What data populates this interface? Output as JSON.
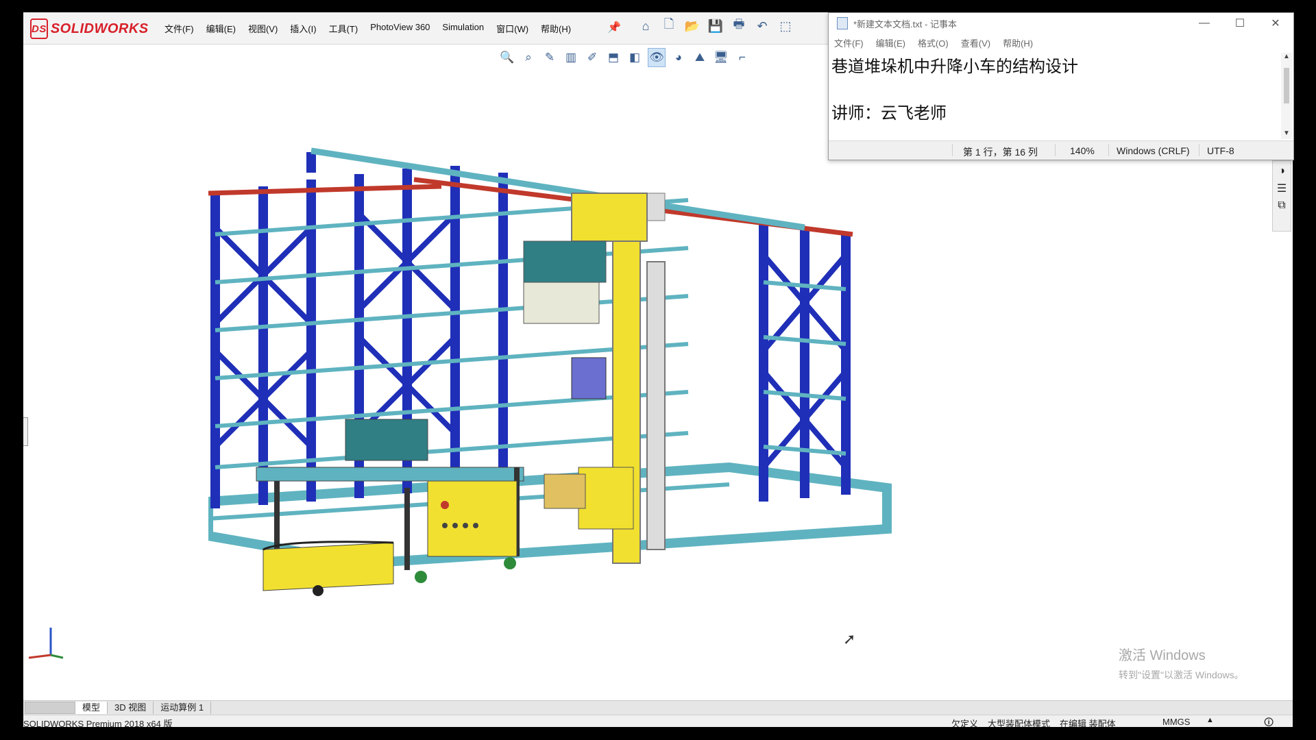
{
  "solidworks": {
    "logo_text": "SOLIDWORKS",
    "logo_mark": "DS",
    "menu": [
      "文件(F)",
      "编辑(E)",
      "视图(V)",
      "插入(I)",
      "工具(T)",
      "PhotoView 360",
      "Simulation",
      "窗口(W)",
      "帮助(H)"
    ],
    "toolbar_icons": [
      "home-icon",
      "new-document-icon",
      "open-icon",
      "save-icon",
      "print-icon",
      "undo-icon",
      "select-icon"
    ],
    "view_toolbar_icons": [
      "zoom-to-fit-icon",
      "zoom-area-icon",
      "previous-view-icon",
      "section-view-icon",
      "dynamic-annotation-icon",
      "view-orientation-icon",
      "display-style-icon",
      "hide-show-icon",
      "edit-appearance-icon",
      "apply-scene-icon",
      "view-settings-icon",
      "display-pane-icon"
    ],
    "bottom_tabs": [
      "模型",
      "3D 视图",
      "运动算例 1"
    ],
    "status": {
      "product": "SOLIDWORKS Premium 2018 x64 版",
      "items": [
        "欠定义",
        "大型装配体模式",
        "在编辑 装配体"
      ],
      "units": "MMGS"
    },
    "watermark": {
      "line1": "激活 Windows",
      "line2": "转到\"设置\"以激活 Windows。"
    }
  },
  "notepad": {
    "title": "*新建文本文档.txt - 记事本",
    "menu": [
      "文件(F)",
      "编辑(E)",
      "格式(O)",
      "查看(V)",
      "帮助(H)"
    ],
    "lines": [
      "巷道堆垛机中升降小车的结构设计",
      "",
      "讲师：云飞老师"
    ],
    "status": {
      "position": "第 1 行，第 16 列",
      "zoom": "140%",
      "line_ending": "Windows (CRLF)",
      "encoding": "UTF-8"
    },
    "controls": [
      "—",
      "☐",
      "✕"
    ]
  },
  "colors": {
    "rack_blue": "#1f2fb8",
    "rack_teal": "#5fb3c0",
    "rail_red": "#c0392b",
    "yellow": "#f1e030",
    "logo_red": "#d8202a"
  }
}
